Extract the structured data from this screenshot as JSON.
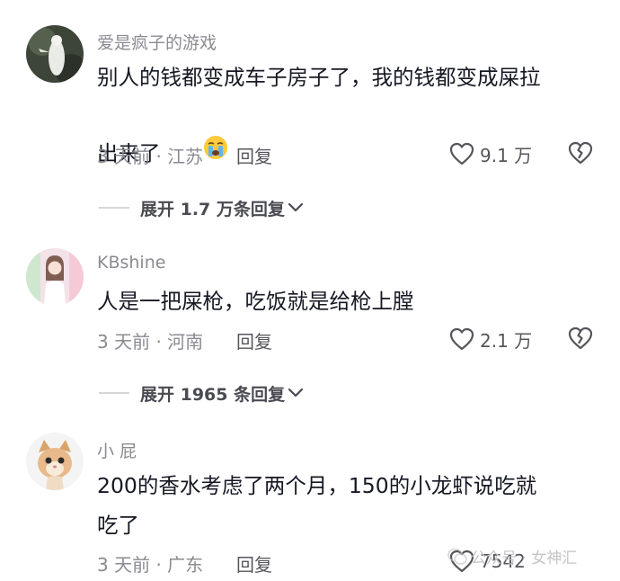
{
  "comments": [
    {
      "username": "爱是疯子的游戏",
      "text": "别人的钱都变成车子房子了，我的钱都变成屎拉\n出来了",
      "emoji": "crying-face-emoji",
      "time_location": "3 天前 · 江苏",
      "reply_label": "回复",
      "likes": "9.1 万",
      "expand_label": "展开 1.7 万条回复"
    },
    {
      "username": "KBshine",
      "text": "人是一把屎枪，吃饭就是给枪上膛",
      "time_location": "3 天前 · 河南",
      "reply_label": "回复",
      "likes": "2.1 万",
      "expand_label": "展开 1965 条回复"
    },
    {
      "username": "小 屁",
      "text": "200的香水考虑了两个月，150的小龙虾说吃就\n吃了",
      "time_location": "3 天前 · 广东",
      "reply_label": "回复",
      "likes": "7542"
    }
  ],
  "watermark": {
    "text": "公众号 · 女神汇",
    "icon": "wechat-icon"
  }
}
